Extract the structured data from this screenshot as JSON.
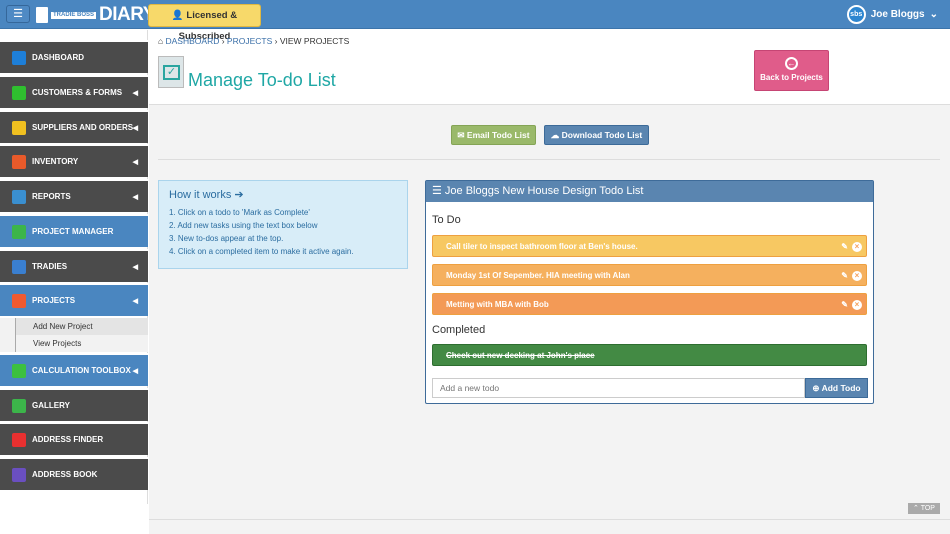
{
  "header": {
    "menu_icon": "☰",
    "logo_small": "TRADIE BOSS",
    "logo_big": "DIARY",
    "licensed": "Licensed & Subscribed",
    "avatar": "sbs",
    "user": "Joe Bloggs"
  },
  "sidebar": {
    "items": [
      {
        "label": "DASHBOARD",
        "color": "#1e7fd8",
        "caret": false,
        "active": false
      },
      {
        "label": "CUSTOMERS & FORMS",
        "color": "#2fbf2f",
        "caret": true,
        "active": false
      },
      {
        "label": "SUPPLIERS AND ORDERS",
        "color": "#f0c020",
        "caret": true,
        "active": false
      },
      {
        "label": "INVENTORY",
        "color": "#e85a2a",
        "caret": true,
        "active": false
      },
      {
        "label": "REPORTS",
        "color": "#3a8fd0",
        "caret": true,
        "active": false
      },
      {
        "label": "PROJECT MANAGER",
        "color": "#3cb54a",
        "caret": false,
        "active": true
      },
      {
        "label": "TRADIES",
        "color": "#3a7fd0",
        "caret": true,
        "active": false
      },
      {
        "label": "PROJECTS",
        "color": "#f05a30",
        "caret": true,
        "active": true
      },
      {
        "label": "CALCULATION TOOLBOX",
        "color": "#3cc040",
        "caret": true,
        "active": true
      },
      {
        "label": "GALLERY",
        "color": "#3cb54a",
        "caret": false,
        "active": false
      },
      {
        "label": "ADDRESS FINDER",
        "color": "#e83030",
        "caret": false,
        "active": false
      },
      {
        "label": "ADDRESS BOOK",
        "color": "#6a4fc0",
        "caret": false,
        "active": false
      }
    ],
    "submenu": [
      "Add New Project",
      "View Projects"
    ]
  },
  "breadcrumb": [
    "DASHBOARD",
    "PROJECTS",
    "VIEW PROJECTS"
  ],
  "page_title": "Manage To-do List",
  "back_button": "Back to Projects",
  "email_button": "Email Todo List",
  "download_button": "Download Todo List",
  "how": {
    "title": "How it works ➔",
    "steps": [
      "1. Click on a todo to 'Mark as Complete'",
      "2. Add new tasks using the text box below",
      "3. New to-dos appear at the top.",
      "4. Click on a completed item to make it active again."
    ]
  },
  "panel": {
    "title": "Joe Bloggs New House Design Todo List",
    "todo_heading": "To Do",
    "todos": [
      {
        "text": "Call tiler to inspect bathroom floor at Ben's house.",
        "color": "#f7c862"
      },
      {
        "text": "Monday 1st Of Sepember. HIA meeting with Alan",
        "color": "#f5b05e"
      },
      {
        "text": "Metting with MBA with Bob",
        "color": "#f39a56"
      }
    ],
    "completed_heading": "Completed",
    "completed": [
      "Check out new decking at John's place"
    ],
    "add_placeholder": "Add a new todo",
    "add_button": "Add Todo"
  },
  "top_button": "TOP"
}
